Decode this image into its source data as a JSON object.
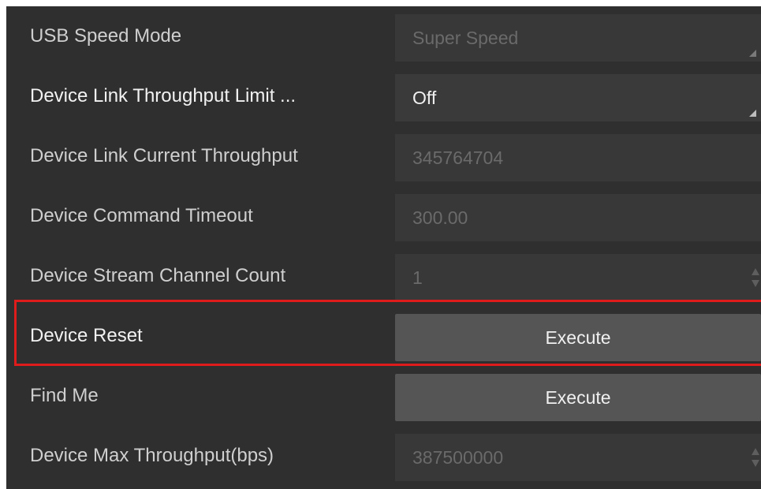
{
  "properties": [
    {
      "label": "USB Speed Mode",
      "value": "Super Speed",
      "control": "dropdown",
      "enabled": false
    },
    {
      "label": "Device Link Throughput Limit ...",
      "value": "Off",
      "control": "dropdown",
      "enabled": true
    },
    {
      "label": "Device Link Current Throughput",
      "value": "345764704",
      "control": "text",
      "enabled": false
    },
    {
      "label": "Device Command Timeout",
      "value": "300.00",
      "control": "text",
      "enabled": false
    },
    {
      "label": "Device Stream Channel Count",
      "value": "1",
      "control": "spinbox",
      "enabled": false
    },
    {
      "label": "Device Reset",
      "value": "Execute",
      "control": "button",
      "enabled": true
    },
    {
      "label": "Find Me",
      "value": "Execute",
      "control": "button",
      "enabled": true
    },
    {
      "label": "Device Max Throughput(bps)",
      "value": "387500000",
      "control": "spinbox",
      "enabled": false
    }
  ],
  "highlight": {
    "target": "Device Reset",
    "color": "#e01b1b"
  },
  "colors": {
    "panel_bg": "#2f2f2f",
    "disabled_field": "#383838",
    "button_bg": "#555555"
  }
}
